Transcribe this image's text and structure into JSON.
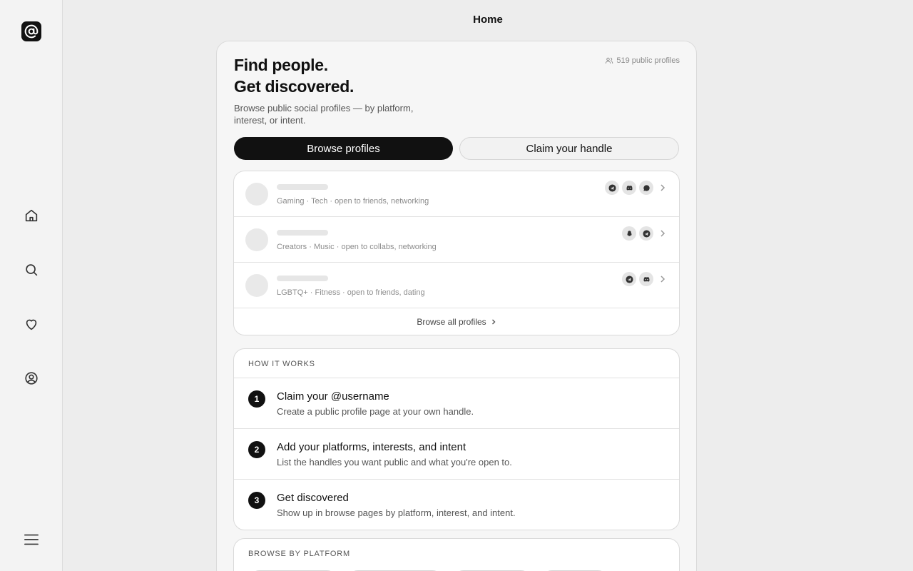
{
  "header": {
    "title": "Home"
  },
  "sidebar": {
    "logo_icon": "at-sign-icon",
    "items": [
      {
        "name": "home",
        "icon": "home-icon"
      },
      {
        "name": "search",
        "icon": "search-icon"
      },
      {
        "name": "favorites",
        "icon": "heart-icon"
      },
      {
        "name": "profile",
        "icon": "user-circle-icon"
      }
    ],
    "menu_icon": "hamburger-menu-icon"
  },
  "hero": {
    "title_line1": "Find people.",
    "title_line2": "Get discovered.",
    "subtitle": "Browse public social profiles — by platform, interest, or intent.",
    "profile_count": "519 public profiles",
    "browse_button": "Browse profiles",
    "claim_button": "Claim your handle"
  },
  "profiles": {
    "rows": [
      {
        "tags": "Gaming · Tech · open to friends, networking",
        "platforms": [
          "telegram",
          "discord",
          "chat"
        ]
      },
      {
        "tags": "Creators · Music · open to collabs, networking",
        "platforms": [
          "snapchat",
          "telegram"
        ]
      },
      {
        "tags": "LGBTQ+ · Fitness · open to friends, dating",
        "platforms": [
          "telegram",
          "discord"
        ]
      }
    ],
    "browse_all": "Browse all profiles"
  },
  "how_it_works": {
    "label": "HOW IT WORKS",
    "steps": [
      {
        "num": "1",
        "title": "Claim your @username",
        "desc": "Create a public profile page at your own handle."
      },
      {
        "num": "2",
        "title": "Add your platforms, interests, and intent",
        "desc": "List the handles you want public and what you're open to."
      },
      {
        "num": "3",
        "title": "Get discovered",
        "desc": "Show up in browse pages by platform, interest, and intent."
      }
    ]
  },
  "browse_by_platform": {
    "label": "BROWSE BY PLATFORM"
  },
  "colors": {
    "accent": "#111111",
    "background": "#ededed",
    "panel": "#f6f6f6"
  }
}
